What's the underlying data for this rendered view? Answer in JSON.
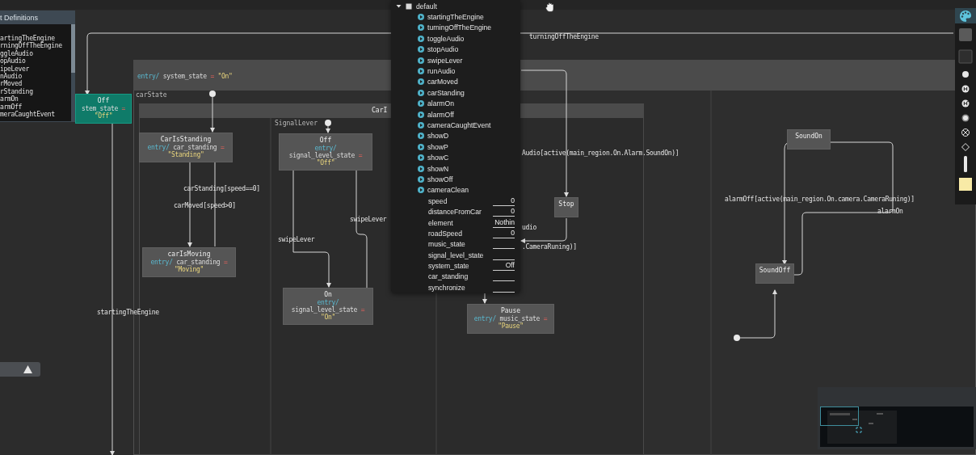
{
  "definitions_panel": {
    "title": "t Definitions",
    "lines": [
      "artingTheEngine",
      "rningOffTheEngine",
      "ggleAudio",
      "opAudio",
      "ipeLever",
      "nAudio",
      "rMoved",
      "rStanding",
      "armOn",
      "armOff",
      "meraCaughtEvent"
    ]
  },
  "warning_button": {
    "disabled": false
  },
  "diagram": {
    "composite_state": {
      "entry": {
        "keyword": "entry/",
        "variable": "system_state",
        "operator": "=",
        "value": "\"On\""
      },
      "region_label": "carState",
      "inner_composite": {
        "name": "CarI",
        "region_label": "SignalLever"
      }
    },
    "states": [
      {
        "name": "Off",
        "entry": {
          "variable": "stem_state",
          "operator": "=",
          "value": "\"Off\""
        },
        "selected": true
      },
      {
        "name": "CarIsStanding",
        "entry": {
          "keyword": "entry/",
          "variable": "car_standing",
          "operator": "=",
          "value": "\"Standing\""
        },
        "selected": false
      },
      {
        "name": "carIsMoving",
        "entry": {
          "keyword": "entry/",
          "variable": "car_standing",
          "operator": "=",
          "value": "\"Moving\""
        },
        "selected": false
      },
      {
        "name": "Off",
        "entry": {
          "keyword": "entry/",
          "variable": "signal_level_state",
          "operator": "=",
          "value": "\"Off\""
        },
        "selected": false
      },
      {
        "name": "On",
        "entry": {
          "keyword": "entry/",
          "variable": "signal_level_state",
          "operator": "=",
          "value": "\"On\""
        },
        "selected": false
      },
      {
        "name": "Stop",
        "selected": false
      },
      {
        "name": "Pause",
        "entry": {
          "keyword": "entry/",
          "variable": "music_state",
          "operator": "=",
          "value": "\"Pause\""
        },
        "selected": false
      },
      {
        "name": "SoundOn",
        "selected": false
      },
      {
        "name": "SoundOff",
        "selected": false
      }
    ],
    "transitions": [
      {
        "label": "turningOffTheEngine"
      },
      {
        "label": "startingTheEngine"
      },
      {
        "label": "carStanding[speed==0]"
      },
      {
        "label": "carMoved[speed>0]"
      },
      {
        "label": "swipeLever"
      },
      {
        "label": "swipeLever"
      },
      {
        "label": "Audio[active(main_region.On.Alarm.SoundOn)]"
      },
      {
        "label": "udio"
      },
      {
        "label": ".CameraRuning)]"
      },
      {
        "label": "alarmOff[active(main_region.On.camera.CameraRuning)]"
      },
      {
        "label": "alarmOn"
      }
    ]
  },
  "variables_popup": {
    "scope": "default",
    "expanded": true,
    "events": [
      "startingTheEngine",
      "turningOffTheEngine",
      "toggleAudio",
      "stopAudio",
      "swipeLever",
      "runAudio",
      "carMoved",
      "carStanding",
      "alarmOn",
      "alarmOff",
      "cameraCaughtEvent",
      "showD",
      "showP",
      "showC",
      "showN",
      "showOff",
      "cameraClean"
    ],
    "variables": [
      {
        "name": "speed",
        "value": "0"
      },
      {
        "name": "distanceFromCar",
        "value": "0"
      },
      {
        "name": "element",
        "value": "Nothin"
      },
      {
        "name": "roadSpeed",
        "value": "0"
      },
      {
        "name": "music_state"
      },
      {
        "name": "signal_level_state"
      },
      {
        "name": "system_state",
        "value": "Off"
      },
      {
        "name": "car_standing"
      },
      {
        "name": "synchronize"
      }
    ]
  },
  "palette": [
    {
      "kind": "palette",
      "selected": true
    },
    {
      "kind": "state",
      "selected": false
    },
    {
      "kind": "composite",
      "selected": false
    },
    {
      "kind": "initial",
      "selected": false
    },
    {
      "kind": "shallow-history",
      "selected": false
    },
    {
      "kind": "deep-history",
      "selected": false
    },
    {
      "kind": "final",
      "selected": false
    },
    {
      "kind": "exit",
      "selected": false
    },
    {
      "kind": "choice",
      "selected": false
    },
    {
      "kind": "synchronization",
      "selected": false
    },
    {
      "kind": "note",
      "selected": false
    }
  ]
}
